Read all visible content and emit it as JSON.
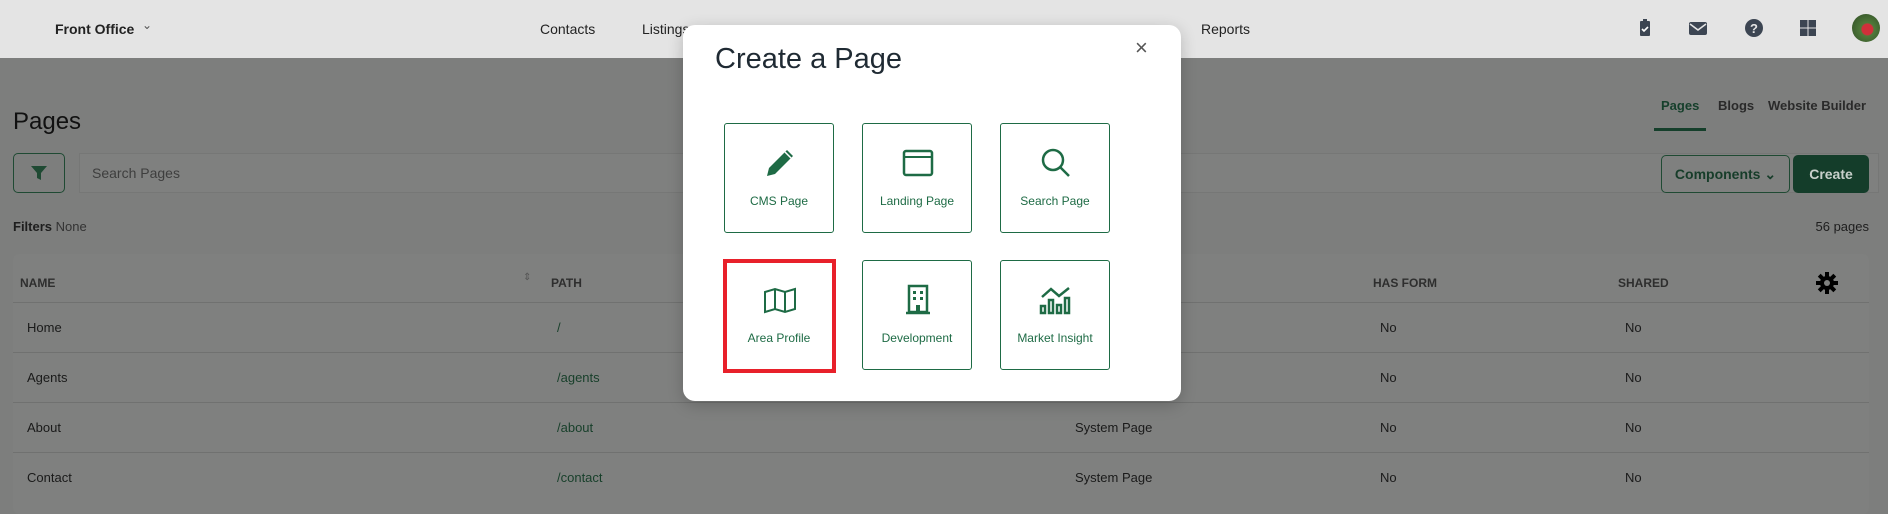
{
  "topbar": {
    "brand": "Front Office",
    "nav": [
      "Contacts",
      "Listings",
      "Reports"
    ],
    "icons": [
      "clipboard-check-icon",
      "mail-icon",
      "help-icon",
      "apps-grid-icon"
    ]
  },
  "page": {
    "title": "Pages",
    "tabs": [
      {
        "label": "Pages",
        "active": true
      },
      {
        "label": "Blogs"
      },
      {
        "label": "Website Builder"
      }
    ],
    "search_placeholder": "Search Pages",
    "components_label": "Components",
    "create_label": "Create",
    "filters_label": "Filters",
    "filters_value": "None",
    "count": "56 pages"
  },
  "table": {
    "headers": {
      "name": "NAME",
      "path": "PATH",
      "has_form": "HAS FORM",
      "shared": "SHARED"
    },
    "rows": [
      {
        "name": "Home",
        "path": "/",
        "type": "",
        "has_form": "No",
        "shared": "No"
      },
      {
        "name": "Agents",
        "path": "/agents",
        "type": "",
        "has_form": "No",
        "shared": "No"
      },
      {
        "name": "About",
        "path": "/about",
        "type": "System Page",
        "has_form": "No",
        "shared": "No"
      },
      {
        "name": "Contact",
        "path": "/contact",
        "type": "System Page",
        "has_form": "No",
        "shared": "No"
      }
    ]
  },
  "modal": {
    "title": "Create a Page",
    "close": "×",
    "tiles": [
      {
        "label": "CMS Page",
        "icon": "pencil-icon"
      },
      {
        "label": "Landing Page",
        "icon": "browser-window-icon"
      },
      {
        "label": "Search Page",
        "icon": "search-icon"
      },
      {
        "label": "Area Profile",
        "icon": "map-icon",
        "highlighted": true
      },
      {
        "label": "Development",
        "icon": "building-icon"
      },
      {
        "label": "Market Insight",
        "icon": "chart-icon"
      }
    ]
  },
  "colors": {
    "accent": "#1e6b45",
    "primary_button": "#143d2a",
    "highlight": "#e8202a"
  }
}
